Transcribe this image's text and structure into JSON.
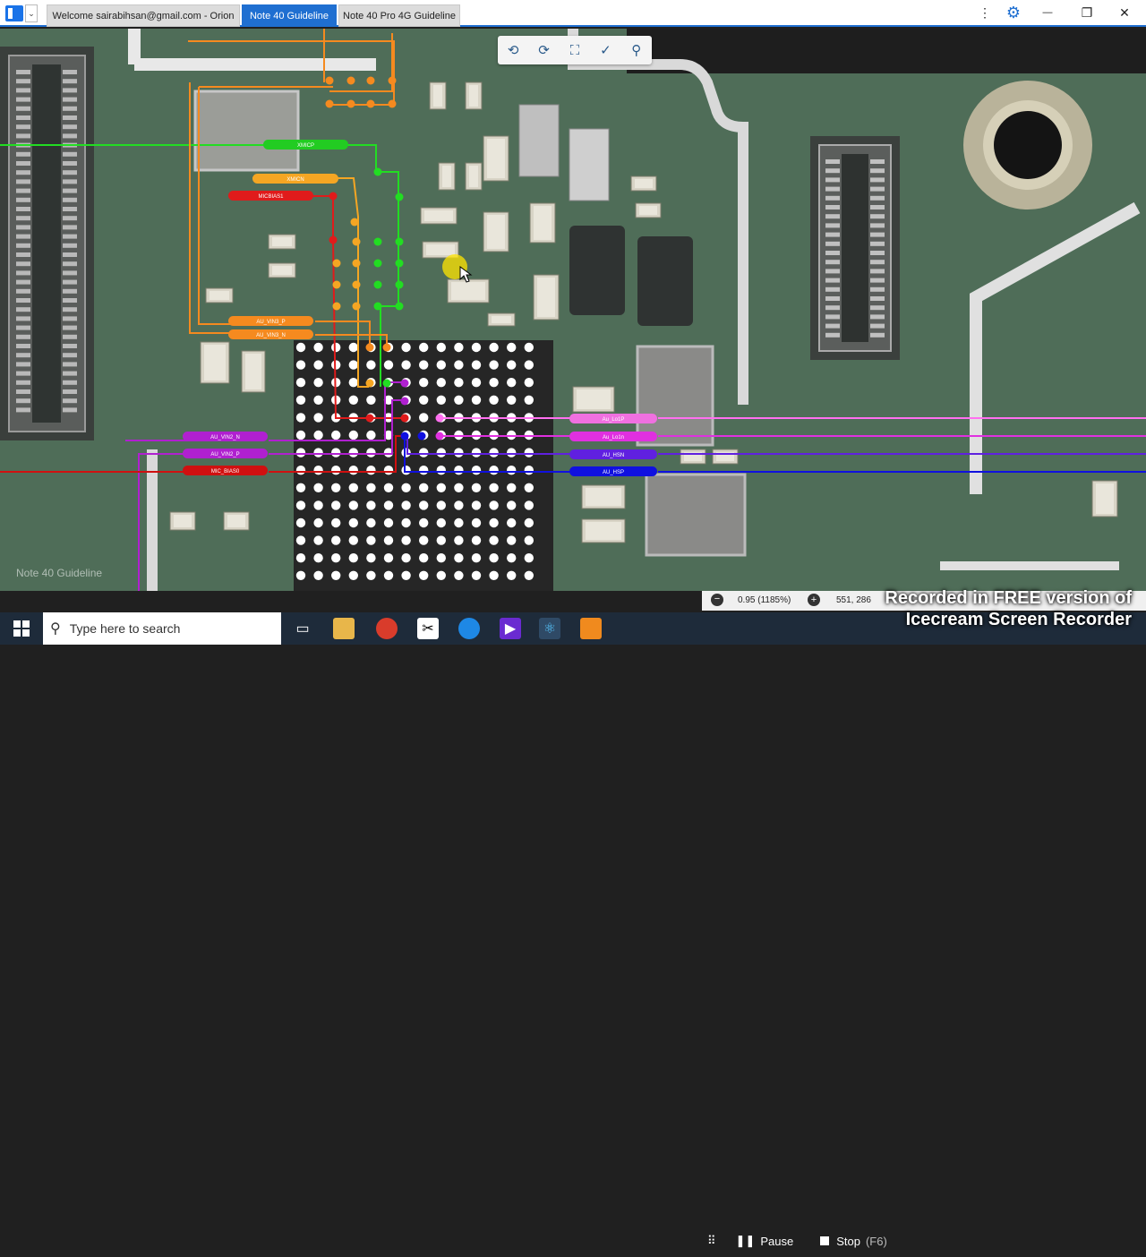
{
  "titlebar": {
    "tabs": [
      {
        "label": "Welcome sairabihsan@gmail.com - Orion",
        "active": false
      },
      {
        "label": "Note 40 Guideline",
        "active": true
      },
      {
        "label": "Note 40 Pro 4G Guideline",
        "active": false
      }
    ],
    "controls": {
      "more": "⋮",
      "settings": "⚙",
      "minimize": "—",
      "restore": "❐",
      "close": "✕"
    }
  },
  "view_toolbar": {
    "icons": [
      "rotate-left-icon",
      "rotate-right-icon",
      "fit-screen-icon",
      "measure-tool-icon",
      "zoom-search-icon"
    ]
  },
  "board": {
    "watermark": "Note 40 Guideline",
    "net_labels": [
      {
        "id": "XMICP",
        "color": "#22cc22"
      },
      {
        "id": "XMICN",
        "color": "#f5a623"
      },
      {
        "id": "MICBIAS1",
        "color": "#e01b1b"
      },
      {
        "id": "AU_VIN3_P",
        "color": "#f58a1f"
      },
      {
        "id": "AU_VIN3_N",
        "color": "#f58a1f"
      },
      {
        "id": "AU_VIN2_N",
        "color": "#b020d0"
      },
      {
        "id": "AU_VIN2_P",
        "color": "#b020d0"
      },
      {
        "id": "MIC_BIAS0",
        "color": "#d01010"
      },
      {
        "id": "Au_Lo1P",
        "color": "#f070e0"
      },
      {
        "id": "Au_Lo1n",
        "color": "#e030e0"
      },
      {
        "id": "AU_HSN",
        "color": "#6020e0"
      },
      {
        "id": "AU_HSP",
        "color": "#1010e0"
      }
    ]
  },
  "statusbar": {
    "zoom": "0.95 (1185%)",
    "coords": "551, 286"
  },
  "recorder": {
    "notice_line1": "Recorded in FREE version of",
    "notice_line2": "Icecream  Screen  Recorder",
    "pause": "Pause",
    "stop": "Stop",
    "stop_hint": "(F6)"
  },
  "taskbar": {
    "search_placeholder": "Type here to search",
    "apps": [
      "task-view-icon",
      "file-explorer-icon",
      "chrome-icon",
      "capcut-icon",
      "edge-icon",
      "video-editor-icon",
      "electron-app-icon",
      "icecream-recorder-icon"
    ]
  }
}
